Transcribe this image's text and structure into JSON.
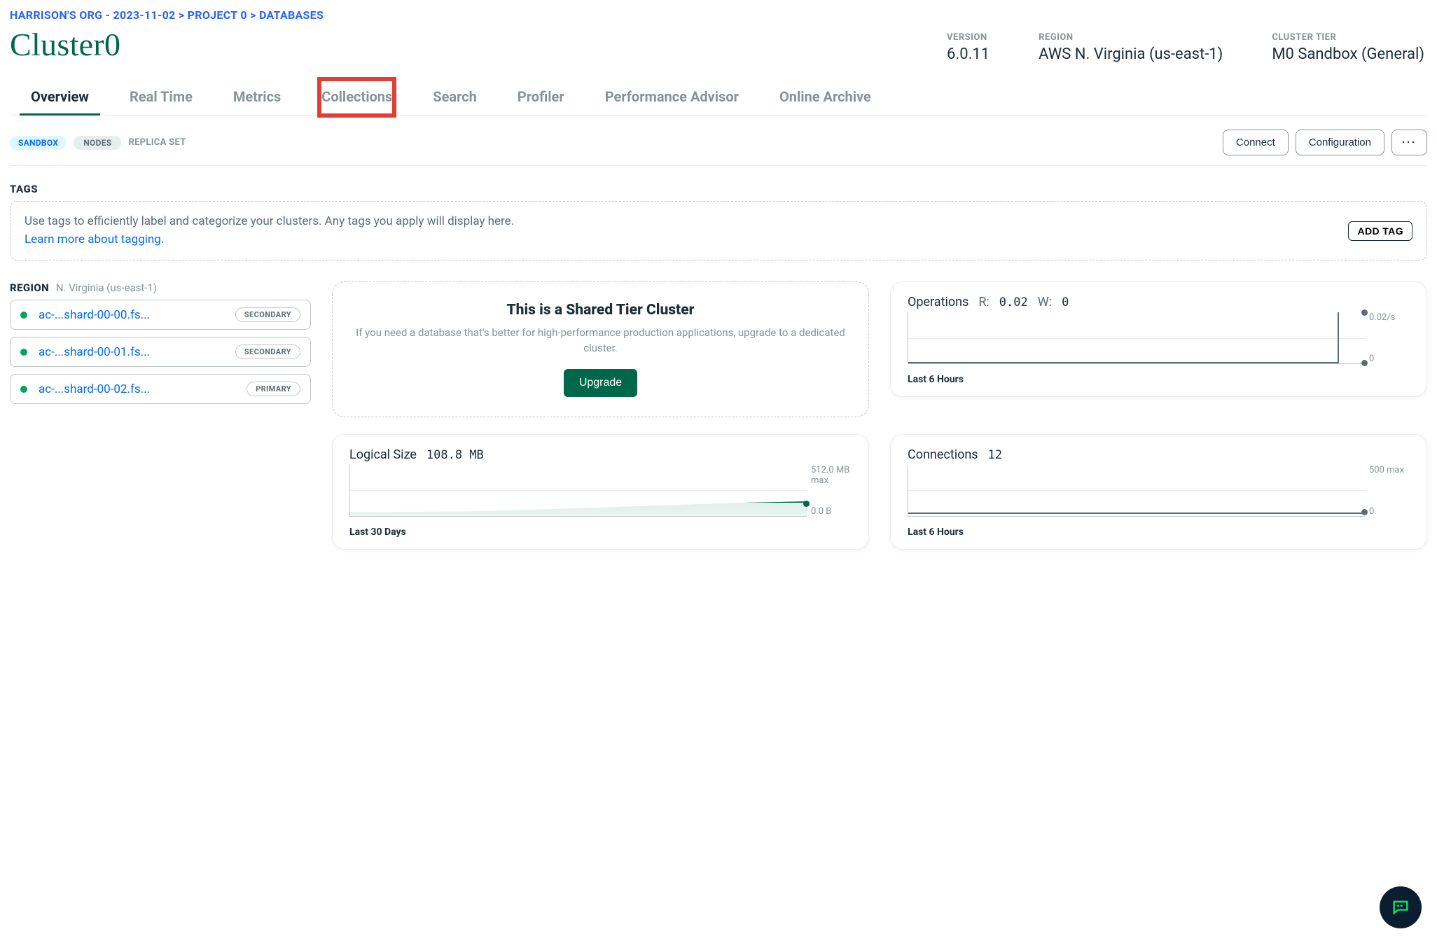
{
  "breadcrumb": {
    "org": "HARRISON'S ORG - 2023-11-02",
    "project": "PROJECT 0",
    "section": "DATABASES"
  },
  "cluster_name": "Cluster0",
  "meta": {
    "version_label": "VERSION",
    "version_value": "6.0.11",
    "region_label": "REGION",
    "region_value": "AWS N. Virginia (us-east-1)",
    "tier_label": "CLUSTER TIER",
    "tier_value": "M0 Sandbox (General)"
  },
  "tabs": [
    {
      "id": "overview",
      "label": "Overview",
      "active": true
    },
    {
      "id": "realtime",
      "label": "Real Time"
    },
    {
      "id": "metrics",
      "label": "Metrics"
    },
    {
      "id": "collections",
      "label": "Collections",
      "highlight": true
    },
    {
      "id": "search",
      "label": "Search"
    },
    {
      "id": "profiler",
      "label": "Profiler"
    },
    {
      "id": "advisor",
      "label": "Performance Advisor"
    },
    {
      "id": "archive",
      "label": "Online Archive"
    }
  ],
  "status_badges": {
    "sandbox": "SANDBOX",
    "nodes": "NODES",
    "replica": "REPLICA SET"
  },
  "actions": {
    "connect": "Connect",
    "config": "Configuration",
    "more": "···"
  },
  "tags": {
    "title": "TAGS",
    "text": "Use tags to efficiently label and categorize your clusters. Any tags you apply will display here.",
    "link": "Learn more about tagging.",
    "add": "ADD TAG"
  },
  "region_panel": {
    "label": "REGION",
    "value": "N. Virginia (us-east-1)",
    "nodes": [
      {
        "name": "ac-...shard-00-00.fs...",
        "role": "SECONDARY"
      },
      {
        "name": "ac-...shard-00-01.fs...",
        "role": "SECONDARY"
      },
      {
        "name": "ac-...shard-00-02.fs...",
        "role": "PRIMARY"
      }
    ]
  },
  "shared_card": {
    "title": "This is a Shared Tier Cluster",
    "desc": "If you need a database that's better for high-performance production applications, upgrade to a dedicated cluster.",
    "button": "Upgrade"
  },
  "chart_data": [
    {
      "id": "operations",
      "type": "line",
      "title": "Operations",
      "series_labels": {
        "R": "R:",
        "W": "W:"
      },
      "series_values": {
        "R": "0.02",
        "W": "0"
      },
      "ylabels_top": "0.02/s",
      "ylabels_bottom": "0",
      "range_label": "Last 6 Hours",
      "values": [
        0,
        0,
        0,
        0,
        0,
        0,
        0,
        0,
        0,
        0,
        0,
        0.02
      ]
    },
    {
      "id": "logical_size",
      "type": "area",
      "title": "Logical Size",
      "value": "108.8 MB",
      "ylabels_top": "512.0 MB max",
      "ylabels_bottom": "0.0 B",
      "range_label": "Last 30 Days",
      "values": [
        40,
        42,
        48,
        58,
        72,
        92,
        95
      ]
    },
    {
      "id": "connections",
      "type": "line",
      "title": "Connections",
      "value": "12",
      "ylabels_top": "500 max",
      "ylabels_bottom": "0",
      "range_label": "Last 6 Hours",
      "values": [
        12,
        12,
        12,
        12,
        12,
        12,
        12
      ]
    }
  ]
}
